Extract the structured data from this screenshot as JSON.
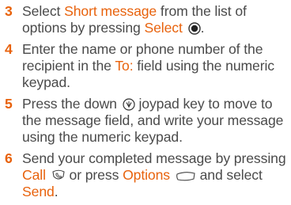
{
  "steps": [
    {
      "number": "3",
      "t1": "Select ",
      "h1": "Short message",
      "t2": " from the list of options by pressing ",
      "h2": "Select",
      "t3": ".",
      "icon": "select-center-key-icon"
    },
    {
      "number": "4",
      "t1": "Enter the name or phone number of the recipient in the ",
      "h1": "To:",
      "t2": " field using the numeric keypad."
    },
    {
      "number": "5",
      "t1": "Press the down ",
      "t2": " joypad key to move to the message field, and write your message using the numeric keypad.",
      "icon": "joypad-down-icon"
    },
    {
      "number": "6",
      "t1": "Send your completed message by pressing ",
      "h1": "Call",
      "t2": " or press ",
      "h2": "Options",
      "t3": " and select ",
      "h3": "Send",
      "t4": ".",
      "icons": [
        "call-key-icon",
        "options-softkey-icon"
      ]
    }
  ],
  "colors": {
    "body_text": "#4a4a4a",
    "highlight": "#e8620c"
  }
}
